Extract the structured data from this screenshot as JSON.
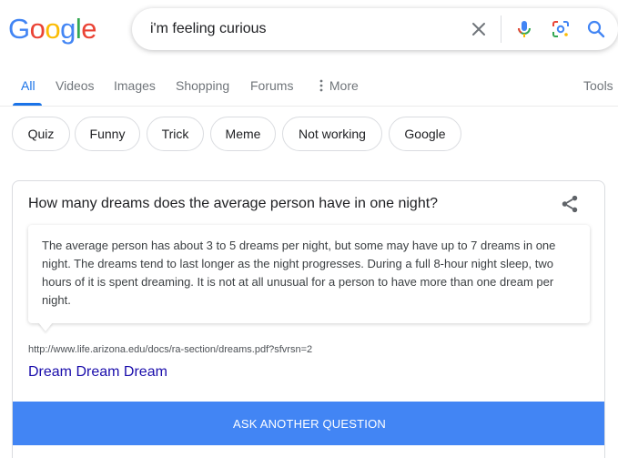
{
  "logo": {
    "letters": [
      {
        "char": "G",
        "color": "#4285F4"
      },
      {
        "char": "o",
        "color": "#EA4335"
      },
      {
        "char": "o",
        "color": "#FBBC05"
      },
      {
        "char": "g",
        "color": "#4285F4"
      },
      {
        "char": "l",
        "color": "#34A853"
      },
      {
        "char": "e",
        "color": "#EA4335"
      }
    ]
  },
  "search": {
    "query": "i'm feeling curious",
    "icons": [
      "clear-icon",
      "microphone-icon",
      "lens-icon",
      "search-icon"
    ]
  },
  "tabs": {
    "items": [
      {
        "label": "All",
        "active": true
      },
      {
        "label": "Videos"
      },
      {
        "label": "Images"
      },
      {
        "label": "Shopping"
      },
      {
        "label": "Forums"
      },
      {
        "label": "More",
        "icon": "more-vert-icon"
      }
    ],
    "tools": "Tools"
  },
  "chips": [
    "Quiz",
    "Funny",
    "Trick",
    "Meme",
    "Not working",
    "Google"
  ],
  "card": {
    "question": "How many dreams does the average person have in one night?",
    "answer": "The average person has about 3 to 5 dreams per night, but some may have up to 7 dreams in one night. The dreams tend to last longer as the night progresses. During a full 8-hour night sleep, two hours of it is spent dreaming. It is not at all unusual for a person to have more than one dream per night.",
    "source_url": "http://www.life.arizona.edu/docs/ra-section/dreams.pdf?sfvrsn=2",
    "source_title": "Dream Dream Dream",
    "button": "ASK ANOTHER QUESTION"
  },
  "colors": {
    "accent": "#1a73e8",
    "button": "#4285f4",
    "link": "#1a0dab"
  }
}
